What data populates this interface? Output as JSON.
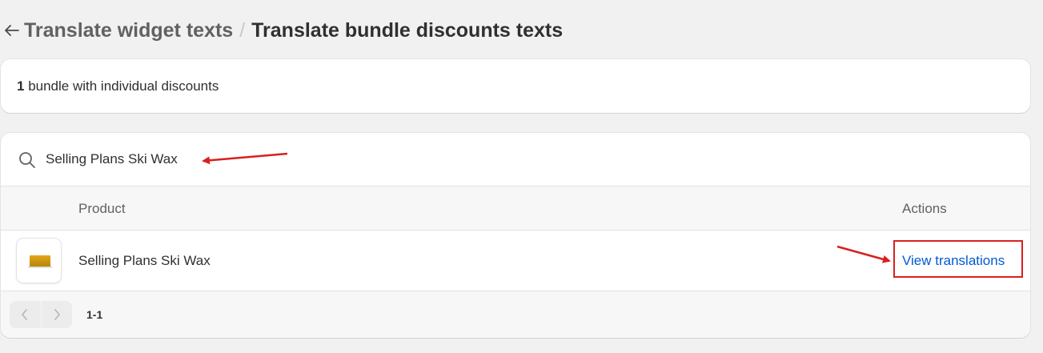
{
  "header": {
    "back_icon": "arrow-left-icon",
    "breadcrumb_parent": "Translate widget texts",
    "breadcrumb_separator": "/",
    "title": "Translate bundle discounts texts"
  },
  "summary": {
    "count": "1",
    "text": " bundle with individual discounts"
  },
  "search": {
    "icon": "search-icon",
    "value": "Selling Plans Ski Wax"
  },
  "table": {
    "columns": [
      "Product",
      "Actions"
    ],
    "rows": [
      {
        "product": "Selling Plans Ski Wax",
        "thumbnail_icon": "ski-wax-product-image",
        "action": "View translations"
      }
    ]
  },
  "pagination": {
    "prev_icon": "chevron-left-icon",
    "next_icon": "chevron-right-icon",
    "label": "1-1"
  },
  "annotations": {
    "arrow_color": "#d92020",
    "highlight_color": "#d92020"
  },
  "colors": {
    "background": "#f1f1f1",
    "card": "#ffffff",
    "link": "#005bd3",
    "annotation": "#d92020"
  }
}
